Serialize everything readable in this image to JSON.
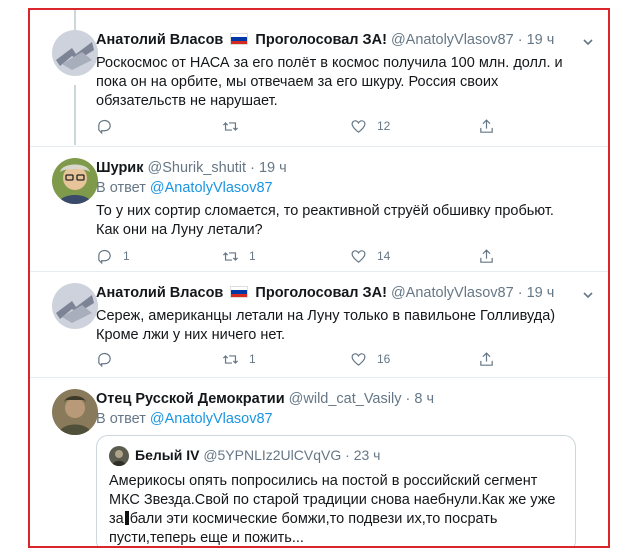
{
  "colors": {
    "accent": "#1b95e0",
    "secondary": "#657786",
    "frame": "#d9262b",
    "like": "#657786"
  },
  "tweets": [
    {
      "name": "Анатолий Власов",
      "flag": "flag-russia",
      "name_suffix": "Проголосовал ЗА!",
      "handle": "@AnatolyVlasov87",
      "dot": "·",
      "time": "19 ч",
      "text": "Роскосмос от НАСА за его полёт в космос получила 100 млн. долл. и пока он на орбите, мы отвечаем за его шкуру. Россия своих обязательств не нарушает.",
      "replies": "",
      "retweets": "",
      "likes": "12"
    },
    {
      "name": "Шурик",
      "handle": "@Shurik_shutit",
      "dot": "·",
      "time": "19 ч",
      "reply_prefix": "В ответ",
      "reply_handle": "@AnatolyVlasov87",
      "text": "То у них сортир сломается, то реактивной струёй обшивку пробьют. Как они на Луну летали?",
      "replies": "1",
      "retweets": "1",
      "likes": "14"
    },
    {
      "name": "Анатолий Власов",
      "flag": "flag-russia",
      "name_suffix": "Проголосовал ЗА!",
      "handle": "@AnatolyVlasov87",
      "dot": "·",
      "time": "19 ч",
      "text": "Сереж, американцы летали на Луну только в павильоне Голливуда) Кроме лжи у них ничего нет.",
      "replies": "",
      "retweets": "1",
      "likes": "16"
    },
    {
      "name": "Отец Русской Демократии",
      "handle": "@wild_cat_Vasily",
      "dot": "·",
      "time": "8 ч",
      "reply_prefix": "В ответ",
      "reply_handle": "@AnatolyVlasov87",
      "quote": {
        "name": "Белый IV",
        "handle": "@5YPNLIz2UlCVqVG",
        "dot": "·",
        "time": "23 ч",
        "text_a": "Америкосы опять попросились на постой в российский сегмент МКС Звезда.Свой по старой традиции снова наебнули.Как же уже за",
        "text_b": "бали эти космические бомжи,то подвези их,то посрать пусти,теперь еще и пожить..."
      }
    }
  ]
}
